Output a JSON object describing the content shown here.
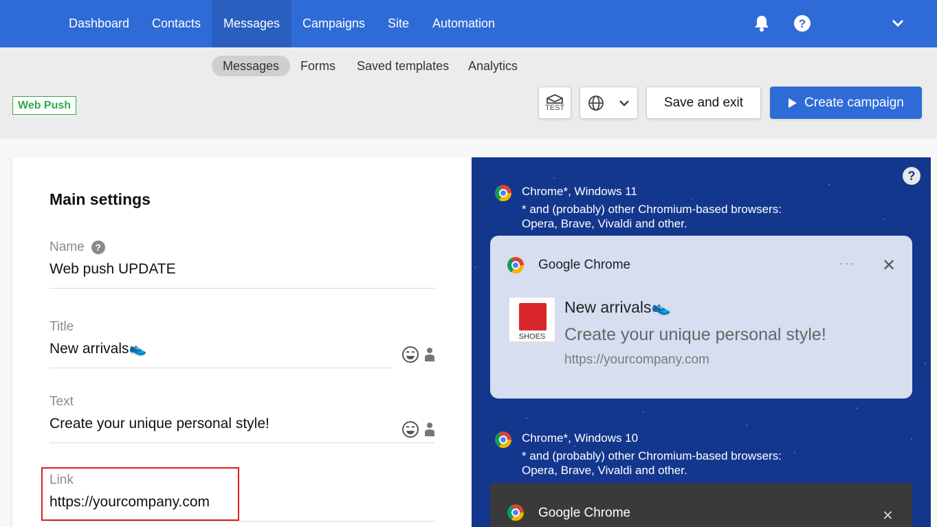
{
  "nav": {
    "items": [
      {
        "label": "Dashboard"
      },
      {
        "label": "Contacts"
      },
      {
        "label": "Messages"
      },
      {
        "label": "Campaigns"
      },
      {
        "label": "Site"
      },
      {
        "label": "Automation"
      }
    ],
    "active": "Messages",
    "icons": [
      "bell-icon",
      "help-icon",
      "chevron-down-icon"
    ]
  },
  "subnav": {
    "items": [
      {
        "label": "Messages"
      },
      {
        "label": "Forms"
      },
      {
        "label": "Saved templates"
      },
      {
        "label": "Analytics"
      }
    ],
    "active": "Messages"
  },
  "toolbar": {
    "badge": "Web Push",
    "test_label": "TEST",
    "save_label": "Save and exit",
    "create_label": "Create campaign"
  },
  "form": {
    "section_title": "Main settings",
    "name": {
      "label": "Name",
      "value": "Web push UPDATE"
    },
    "title": {
      "label": "Title",
      "value": "New arrivals👟"
    },
    "text": {
      "label": "Text",
      "value": "Create your unique personal style!"
    },
    "link": {
      "label": "Link",
      "value": "https://yourcompany.com"
    }
  },
  "preview": {
    "win11": {
      "name": "Chrome*, Windows 11",
      "note1": "* and (probably) other Chromium-based browsers:",
      "note2": "Opera, Brave, Vivaldi and other."
    },
    "card1": {
      "app": "Google Chrome",
      "title": "New arrivals👟",
      "body": "Create your unique personal style!",
      "url": "https://yourcompany.com",
      "thumb_caption": "SHOES",
      "dots": "···",
      "close": "✕"
    },
    "win10": {
      "name": "Chrome*, Windows 10",
      "note1": "* and (probably) other Chromium-based browsers:",
      "note2": "Opera, Brave, Vivaldi and other."
    },
    "card2": {
      "app": "Google Chrome",
      "close": "✕"
    }
  },
  "colors": {
    "nav_bg": "#2f6bd6",
    "preview_bg": "#14378e",
    "badge_green": "#2eaa4a",
    "highlight_red": "#e01b1b"
  }
}
